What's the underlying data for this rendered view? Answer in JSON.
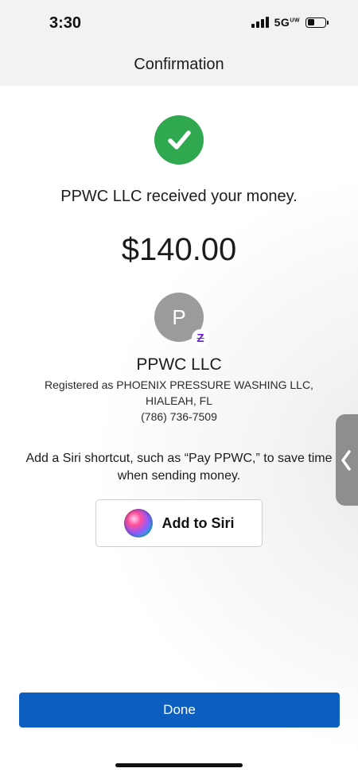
{
  "status_bar": {
    "time": "3:30",
    "network": "5G",
    "network_suffix": "UW",
    "battery_level": 0.4
  },
  "header": {
    "title": "Confirmation"
  },
  "confirmation": {
    "check_icon": "checkmark-circle-icon",
    "message": "PPWC LLC received your money.",
    "amount": "$140.00"
  },
  "recipient": {
    "avatar_initial": "P",
    "badge_icon": "zelle-icon",
    "badge_glyph": "Z",
    "name": "PPWC LLC",
    "registered_line1": "Registered as PHOENIX PRESSURE WASHING LLC,",
    "registered_line2": "HIALEAH, FL",
    "phone": "(786) 736-7509"
  },
  "siri": {
    "prompt": "Add a Siri shortcut, such as “Pay PPWC,” to save time when sending money.",
    "button_label": "Add to Siri",
    "orb_icon": "siri-orb-icon"
  },
  "footer": {
    "done_label": "Done"
  },
  "colors": {
    "success": "#2fa84f",
    "primary": "#0d5fbf",
    "zelle": "#6d1ed4",
    "avatar": "#9b9b9b"
  }
}
